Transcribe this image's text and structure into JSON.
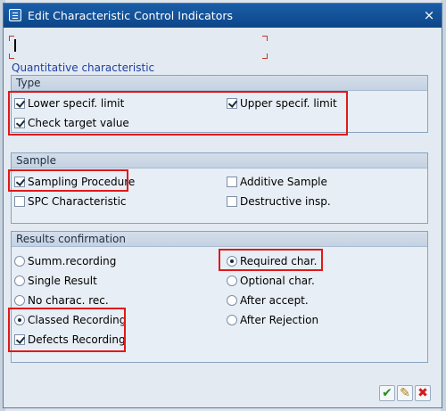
{
  "window": {
    "title": "Edit Characteristic Control Indicators",
    "close_glyph": "×"
  },
  "input": {
    "value": ""
  },
  "characteristic_type": "Quantitative characteristic",
  "type_group": {
    "heading": "Type",
    "lower_spec": {
      "label": "Lower specif. limit",
      "checked": true
    },
    "upper_spec": {
      "label": "Upper specif. limit",
      "checked": true
    },
    "check_target": {
      "label": "Check target value",
      "checked": true
    }
  },
  "sample_group": {
    "heading": "Sample",
    "sampling_procedure": {
      "label": "Sampling Procedure",
      "checked": true
    },
    "additive_sample": {
      "label": "Additive Sample",
      "checked": false
    },
    "spc_characteristic": {
      "label": "SPC Characteristic",
      "checked": false
    },
    "destructive_insp": {
      "label": "Destructive insp.",
      "checked": false
    }
  },
  "results_group": {
    "heading": "Results confirmation",
    "summ_recording": {
      "label": "Summ.recording",
      "selected": false
    },
    "required_char": {
      "label": "Required char.",
      "selected": true
    },
    "single_result": {
      "label": "Single Result",
      "selected": false
    },
    "optional_char": {
      "label": "Optional char.",
      "selected": false
    },
    "no_charac_rec": {
      "label": "No charac. rec.",
      "selected": false
    },
    "after_accept": {
      "label": "After accept.",
      "selected": false
    },
    "classed_recording": {
      "label": "Classed Recording",
      "selected": true
    },
    "after_rejection": {
      "label": "After Rejection",
      "selected": false
    },
    "defects_recording": {
      "label": "Defects Recording",
      "checked": true
    }
  },
  "footer": {
    "ok_glyph": "✔",
    "check_glyph": "✎",
    "cancel_glyph": "✖"
  },
  "colors": {
    "title_bar": "#0d4587",
    "highlight": "#e01919",
    "link_text": "#1d3fa0"
  }
}
